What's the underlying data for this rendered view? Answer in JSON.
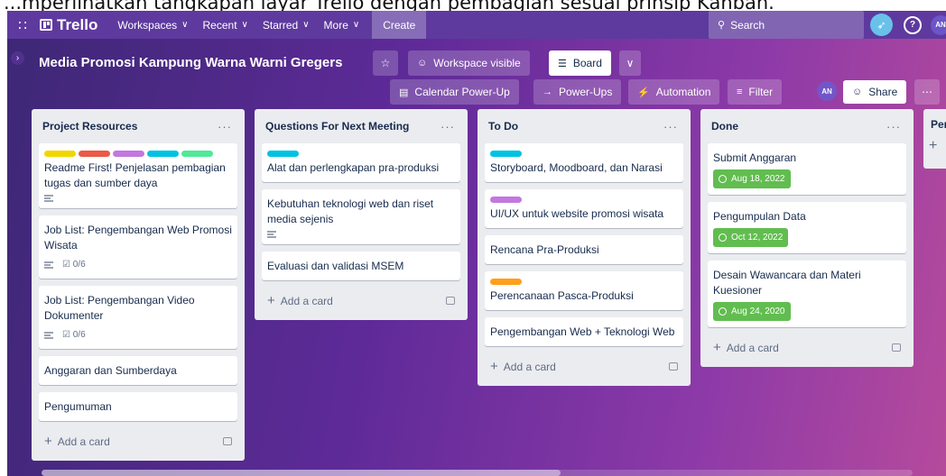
{
  "caption": "...mperlihatkan tangkapan layar Trello dengan pembagian sesuai prinsip Kanban.",
  "topbar": {
    "app_name": "Trello",
    "workspaces": "Workspaces",
    "recent": "Recent",
    "starred": "Starred",
    "more": "More",
    "create": "Create",
    "search": "Search",
    "avatar": "AN"
  },
  "board": {
    "title": "Media Promosi Kampung Warna Warni Gregers",
    "visibility": "Workspace visible",
    "view": "Board",
    "calendar": "Calendar Power-Up",
    "powerups": "Power-Ups",
    "automation": "Automation",
    "filter": "Filter",
    "member": "AN",
    "share": "Share"
  },
  "colors": {
    "green": "#61bd4f",
    "yellow": "#f2d600",
    "red": "#eb5a46",
    "purple": "#c377e0",
    "sky": "#00c2e0",
    "lime": "#51e898",
    "orange": "#ff9f1a"
  },
  "lists": [
    {
      "title": "Project Resources",
      "add": "Add a card",
      "cards": [
        {
          "labels": [
            "yellow",
            "red",
            "purple",
            "sky",
            "lime"
          ],
          "title": "Readme First! Penjelasan pembagian tugas dan sumber daya",
          "description": true
        },
        {
          "title": "Job List: Pengembangan Web Promosi Wisata",
          "description": true,
          "checklist": "0/6"
        },
        {
          "title": "Job List: Pengembangan Video Dokumenter",
          "description": true,
          "checklist": "0/6"
        },
        {
          "title": "Anggaran dan Sumberdaya"
        },
        {
          "title": "Pengumuman"
        }
      ]
    },
    {
      "title": "Questions For Next Meeting",
      "add": "Add a card",
      "cards": [
        {
          "labels": [
            "sky"
          ],
          "title": "Alat dan perlengkapan pra-produksi"
        },
        {
          "title": "Kebutuhan teknologi web dan riset media sejenis",
          "description": true
        },
        {
          "title": "Evaluasi dan validasi MSEM"
        }
      ]
    },
    {
      "title": "To Do",
      "add": "Add a card",
      "cards": [
        {
          "labels": [
            "sky"
          ],
          "title": "Storyboard, Moodboard, dan Narasi"
        },
        {
          "labels": [
            "purple"
          ],
          "title": "UI/UX untuk website promosi wisata"
        },
        {
          "title": "Rencana Pra-Produksi"
        },
        {
          "labels": [
            "orange"
          ],
          "title": "Perencanaan Pasca-Produksi"
        },
        {
          "title": "Pengembangan Web + Teknologi Web"
        }
      ]
    },
    {
      "title": "Done",
      "add": "Add a card",
      "cards": [
        {
          "title": "Submit Anggaran",
          "due": "Aug 18, 2022"
        },
        {
          "title": "Pengumpulan Data",
          "due": "Oct 12, 2022"
        },
        {
          "title": "Desain Wawancara dan Materi Kuesioner",
          "due": "Aug 24, 2020"
        }
      ]
    }
  ],
  "partial_list": {
    "title": "Per",
    "add": "+"
  }
}
